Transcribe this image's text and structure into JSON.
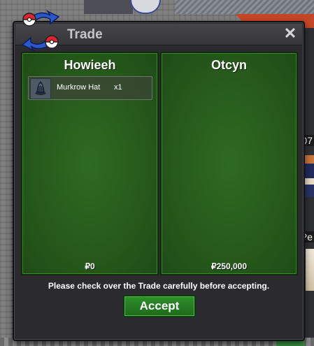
{
  "window": {
    "title": "Trade",
    "close_label": "✕"
  },
  "left_panel": {
    "player_name": "Howieeh",
    "items": [
      {
        "name": "Murkrow Hat",
        "quantity": "x1",
        "icon": "murkrow-hat-icon"
      }
    ],
    "money": "₽0"
  },
  "right_panel": {
    "player_name": "Otcyn",
    "items": [],
    "money": "₽250,000"
  },
  "notice": "Please check over the Trade carefully before accepting.",
  "accept_label": "Accept",
  "background": {
    "side_label_top": "07",
    "side_label_bottom": "Pe"
  },
  "colors": {
    "panel_green": "#24561a",
    "accept_green": "#2f8e2c",
    "window_bg": "#2b2b2f",
    "title_text": "#c6c6c6"
  }
}
